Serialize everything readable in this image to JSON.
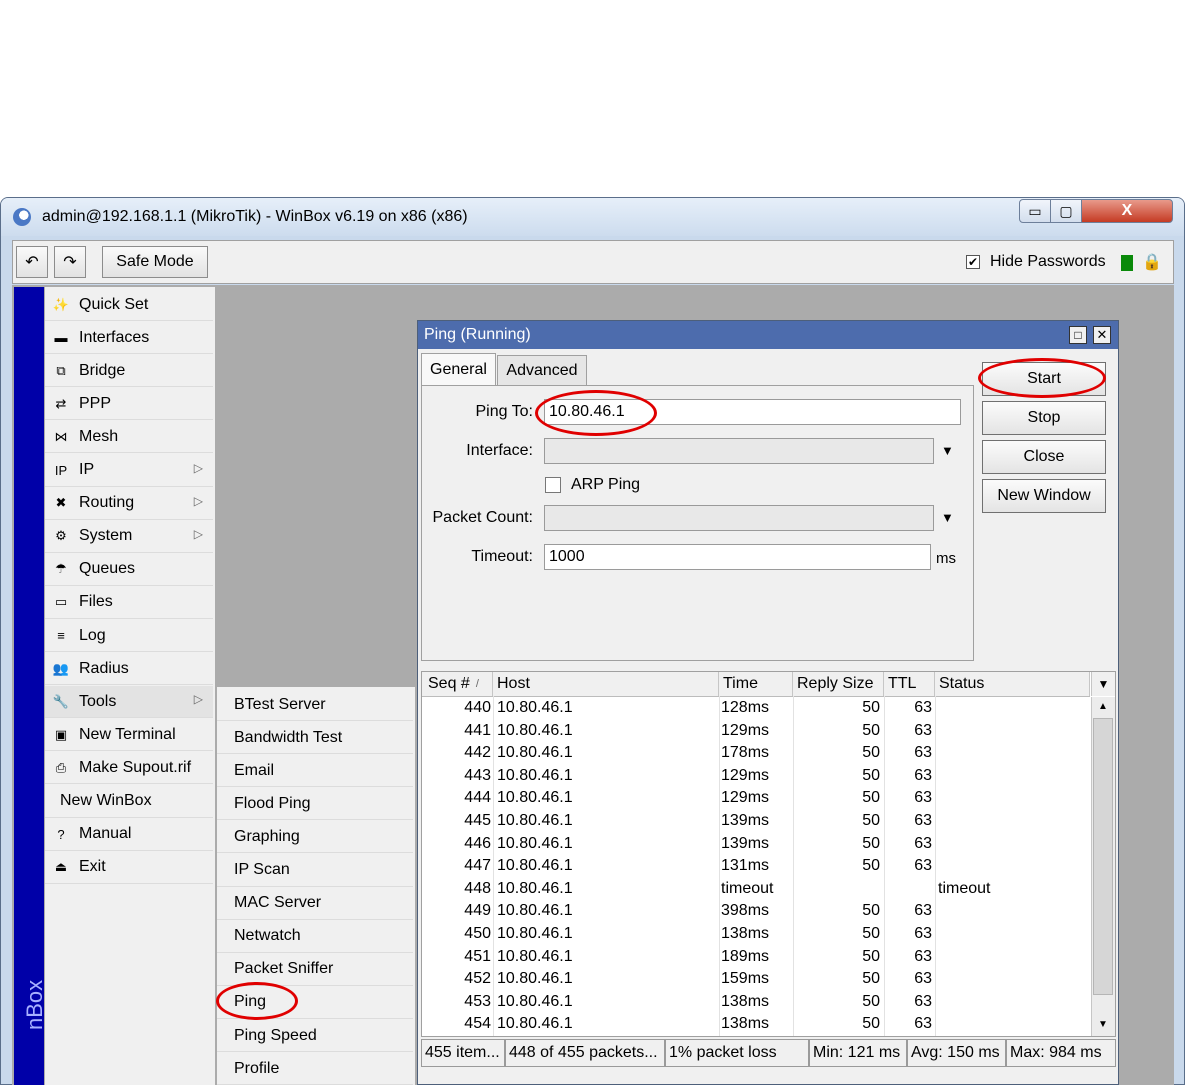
{
  "window": {
    "title": "admin@192.168.1.1 (MikroTik) - WinBox v6.19 on x86 (x86)",
    "caption_min": "▭",
    "caption_max": "▢",
    "caption_close": "X"
  },
  "toolbar": {
    "undo": "↶",
    "redo": "↷",
    "safe_mode": "Safe Mode",
    "hide_passwords": "Hide Passwords",
    "hide_passwords_checked": "✔"
  },
  "brand": "nBox",
  "menu": [
    {
      "label": "Quick Set"
    },
    {
      "label": "Interfaces"
    },
    {
      "label": "Bridge"
    },
    {
      "label": "PPP"
    },
    {
      "label": "Mesh"
    },
    {
      "label": "IP"
    },
    {
      "label": "Routing"
    },
    {
      "label": "System"
    },
    {
      "label": "Queues"
    },
    {
      "label": "Files"
    },
    {
      "label": "Log"
    },
    {
      "label": "Radius"
    },
    {
      "label": "Tools"
    },
    {
      "label": "New Terminal"
    },
    {
      "label": "Make Supout.rif"
    },
    {
      "label": "New WinBox"
    },
    {
      "label": "Manual"
    },
    {
      "label": "Exit"
    }
  ],
  "submenu": [
    {
      "label": "BTest Server"
    },
    {
      "label": "Bandwidth Test"
    },
    {
      "label": "Email"
    },
    {
      "label": "Flood Ping"
    },
    {
      "label": "Graphing"
    },
    {
      "label": "IP Scan"
    },
    {
      "label": "MAC Server"
    },
    {
      "label": "Netwatch"
    },
    {
      "label": "Packet Sniffer"
    },
    {
      "label": "Ping"
    },
    {
      "label": "Ping Speed"
    },
    {
      "label": "Profile"
    }
  ],
  "ping": {
    "title": "Ping (Running)",
    "tabs": [
      "General",
      "Advanced"
    ],
    "ping_to_label": "Ping To:",
    "ping_to_value": "10.80.46.1",
    "interface_label": "Interface:",
    "interface_value": "",
    "arp_ping_label": "ARP Ping",
    "packet_count_label": "Packet Count:",
    "packet_count_value": "",
    "timeout_label": "Timeout:",
    "timeout_value": "1000",
    "timeout_unit": "ms",
    "buttons": {
      "start": "Start",
      "stop": "Stop",
      "close": "Close",
      "new_window": "New Window"
    }
  },
  "table": {
    "columns": [
      "Seq #",
      "Host",
      "Time",
      "Reply Size",
      "TTL",
      "Status"
    ],
    "sort_indicator": "/",
    "rows": [
      {
        "seq": "440",
        "host": "10.80.46.1",
        "time": "128ms",
        "size": "50",
        "ttl": "63",
        "status": ""
      },
      {
        "seq": "441",
        "host": "10.80.46.1",
        "time": "129ms",
        "size": "50",
        "ttl": "63",
        "status": ""
      },
      {
        "seq": "442",
        "host": "10.80.46.1",
        "time": "178ms",
        "size": "50",
        "ttl": "63",
        "status": ""
      },
      {
        "seq": "443",
        "host": "10.80.46.1",
        "time": "129ms",
        "size": "50",
        "ttl": "63",
        "status": ""
      },
      {
        "seq": "444",
        "host": "10.80.46.1",
        "time": "129ms",
        "size": "50",
        "ttl": "63",
        "status": ""
      },
      {
        "seq": "445",
        "host": "10.80.46.1",
        "time": "139ms",
        "size": "50",
        "ttl": "63",
        "status": ""
      },
      {
        "seq": "446",
        "host": "10.80.46.1",
        "time": "139ms",
        "size": "50",
        "ttl": "63",
        "status": ""
      },
      {
        "seq": "447",
        "host": "10.80.46.1",
        "time": "131ms",
        "size": "50",
        "ttl": "63",
        "status": ""
      },
      {
        "seq": "448",
        "host": "10.80.46.1",
        "time": "timeout",
        "size": "",
        "ttl": "",
        "status": "timeout"
      },
      {
        "seq": "449",
        "host": "10.80.46.1",
        "time": "398ms",
        "size": "50",
        "ttl": "63",
        "status": ""
      },
      {
        "seq": "450",
        "host": "10.80.46.1",
        "time": "138ms",
        "size": "50",
        "ttl": "63",
        "status": ""
      },
      {
        "seq": "451",
        "host": "10.80.46.1",
        "time": "189ms",
        "size": "50",
        "ttl": "63",
        "status": ""
      },
      {
        "seq": "452",
        "host": "10.80.46.1",
        "time": "159ms",
        "size": "50",
        "ttl": "63",
        "status": ""
      },
      {
        "seq": "453",
        "host": "10.80.46.1",
        "time": "138ms",
        "size": "50",
        "ttl": "63",
        "status": ""
      },
      {
        "seq": "454",
        "host": "10.80.46.1",
        "time": "138ms",
        "size": "50",
        "ttl": "63",
        "status": ""
      }
    ]
  },
  "statusbar": {
    "items": "455 item...",
    "packets": "448 of 455 packets...",
    "loss": "1% packet loss",
    "min": "Min: 121 ms",
    "avg": "Avg: 150 ms",
    "max": "Max: 984 ms"
  },
  "colors": {
    "brand_strip": "#0000a8",
    "title_bar": "#4d6cad",
    "highlight_ring": "#e00000"
  }
}
